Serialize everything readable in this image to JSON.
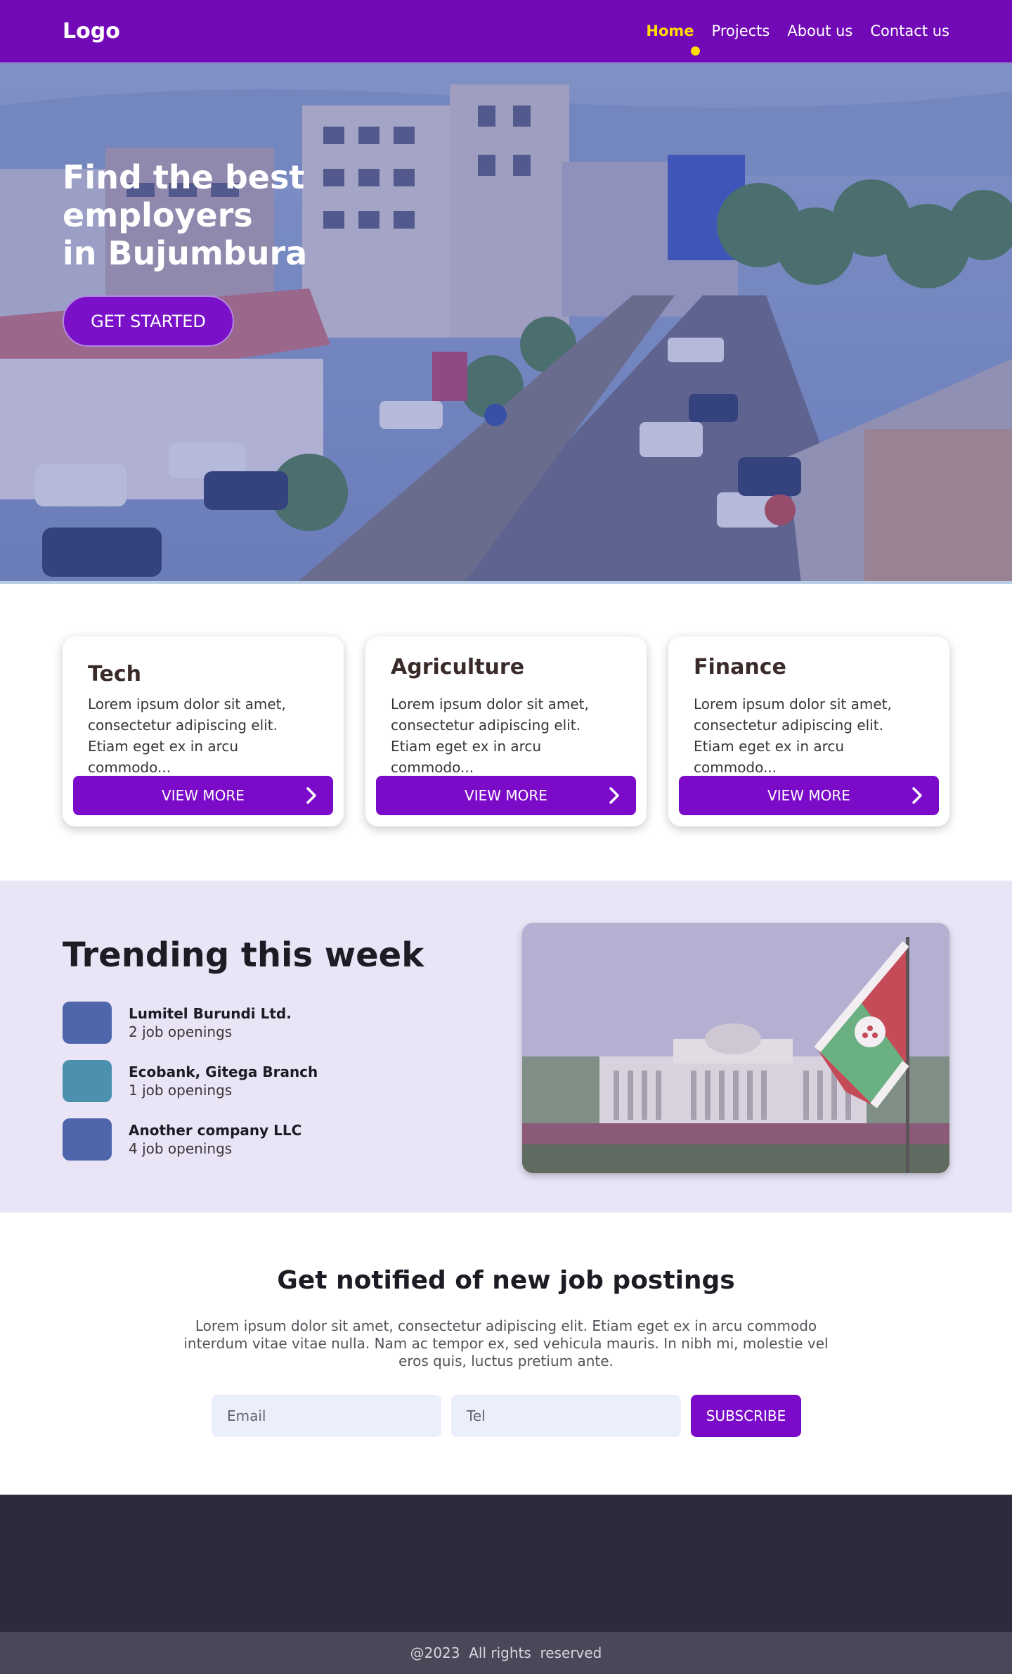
{
  "nav": {
    "logo": "Logo",
    "links": [
      {
        "label": "Home",
        "active": true
      },
      {
        "label": "Projects",
        "active": false
      },
      {
        "label": "About us",
        "active": false
      },
      {
        "label": "Contact us",
        "active": false
      }
    ]
  },
  "hero": {
    "title_line1": "Find the best employers",
    "title_line2": "in Bujumbura",
    "cta": "GET STARTED"
  },
  "cards": [
    {
      "title": "Tech",
      "text": "Lorem ipsum dolor sit amet, consectetur adipiscing elit. Etiam eget ex in arcu commodo...",
      "button": "VIEW MORE"
    },
    {
      "title": "Agriculture",
      "text": "Lorem ipsum dolor sit amet, consectetur adipiscing elit. Etiam eget ex in arcu commodo...",
      "button": "VIEW MORE"
    },
    {
      "title": "Finance",
      "text": "Lorem ipsum dolor sit amet, consectetur adipiscing elit. Etiam eget ex in arcu commodo...",
      "button": "VIEW MORE"
    }
  ],
  "trending": {
    "title": "Trending this week",
    "companies": [
      {
        "name": "Lumitel Burundi Ltd.",
        "openings": "2 job openings",
        "color": "#4f66ac"
      },
      {
        "name": "Ecobank, Gitega Branch",
        "openings": "1 job openings",
        "color": "#4b90ac"
      },
      {
        "name": "Another company LLC",
        "openings": "4 job openings",
        "color": "#4f66ac"
      }
    ]
  },
  "newsletter": {
    "title": "Get notified of new job postings",
    "text": "Lorem ipsum dolor sit amet, consectetur adipiscing elit. Etiam eget ex in arcu commodo interdum vitae vitae nulla. Nam ac tempor ex, sed vehicula mauris. In nibh mi, molestie vel eros quis, luctus pretium ante.",
    "email_placeholder": "Email",
    "tel_placeholder": "Tel",
    "subscribe": "SUBSCRIBE"
  },
  "footer": {
    "copyright": "@2023  All rights  reserved"
  },
  "colors": {
    "brand": "#7209b7",
    "accent": "#ffdd00",
    "button": "#7b0ac9",
    "footer": "#2d2a3b"
  }
}
